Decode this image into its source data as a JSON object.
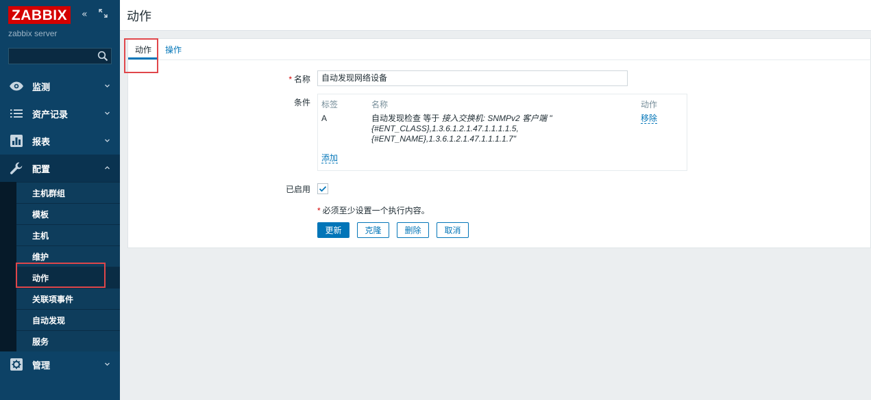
{
  "sidebar": {
    "logo": "ZABBIX",
    "server_name": "zabbix server",
    "search_placeholder": "",
    "menu": [
      {
        "label": "监测",
        "icon": "eye-icon"
      },
      {
        "label": "资产记录",
        "icon": "list-icon"
      },
      {
        "label": "报表",
        "icon": "bar-chart-icon"
      },
      {
        "label": "配置",
        "icon": "wrench-icon"
      },
      {
        "label": "管理",
        "icon": "gear-icon"
      }
    ],
    "submenu": [
      {
        "label": "主机群组"
      },
      {
        "label": "模板"
      },
      {
        "label": "主机"
      },
      {
        "label": "维护"
      },
      {
        "label": "动作"
      },
      {
        "label": "关联项事件"
      },
      {
        "label": "自动发现"
      },
      {
        "label": "服务"
      }
    ]
  },
  "header": {
    "title": "动作"
  },
  "tabs": [
    {
      "label": "动作"
    },
    {
      "label": "操作"
    }
  ],
  "form": {
    "name_label": "名称",
    "name_value": "自动发现网络设备",
    "conditions_label": "条件",
    "conditions": {
      "headers": [
        "标签",
        "名称",
        "动作"
      ],
      "rows": [
        {
          "tag": "A",
          "name_prefix": "自动发现检查 等于 ",
          "name_line1": "接入交换机: SNMPv2 客户端 \"",
          "name_line2": "{#ENT_CLASS},1.3.6.1.2.1.47.1.1.1.1.5,",
          "name_line3": "{#ENT_NAME},1.3.6.1.2.1.47.1.1.1.1.7\"",
          "action": "移除"
        }
      ],
      "add_label": "添加"
    },
    "enabled_label": "已启用",
    "enabled": true,
    "required_note": "必须至少设置一个执行内容。",
    "buttons": {
      "update": "更新",
      "clone": "克隆",
      "delete": "删除",
      "cancel": "取消"
    }
  },
  "colors": {
    "sidebar_bg": "#0d4266",
    "accent": "#0275b8",
    "logo_red": "#d40000",
    "highlight_red": "#e0464a"
  }
}
